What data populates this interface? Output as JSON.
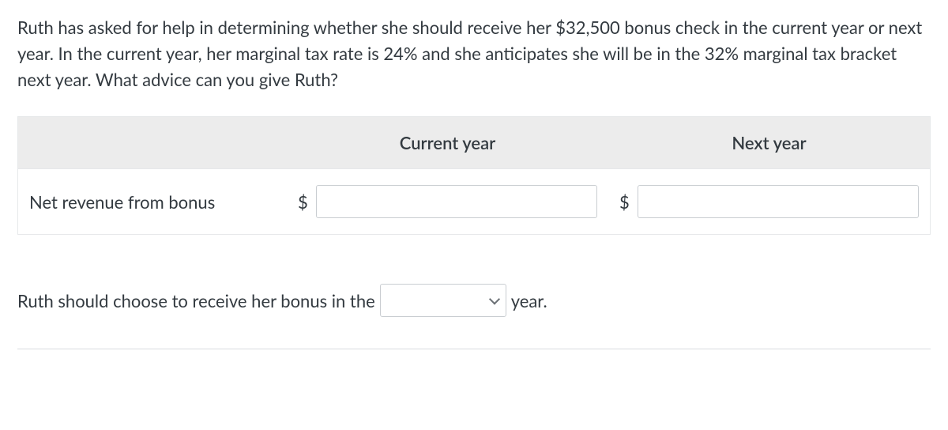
{
  "question": "Ruth has asked for help in determining whether she should receive her $32,500 bonus check in the current year or next year. In the current year, her marginal tax rate is 24% and she anticipates she will be in the 32% marginal tax bracket next year. What advice can you give Ruth?",
  "table": {
    "header_current": "Current year",
    "header_next": "Next year",
    "row_label": "Net revenue from bonus",
    "currency": "$",
    "input_current_value": "",
    "input_next_value": ""
  },
  "sentence": {
    "prefix": "Ruth should choose to receive her bonus in the",
    "suffix": "year.",
    "selected": ""
  }
}
